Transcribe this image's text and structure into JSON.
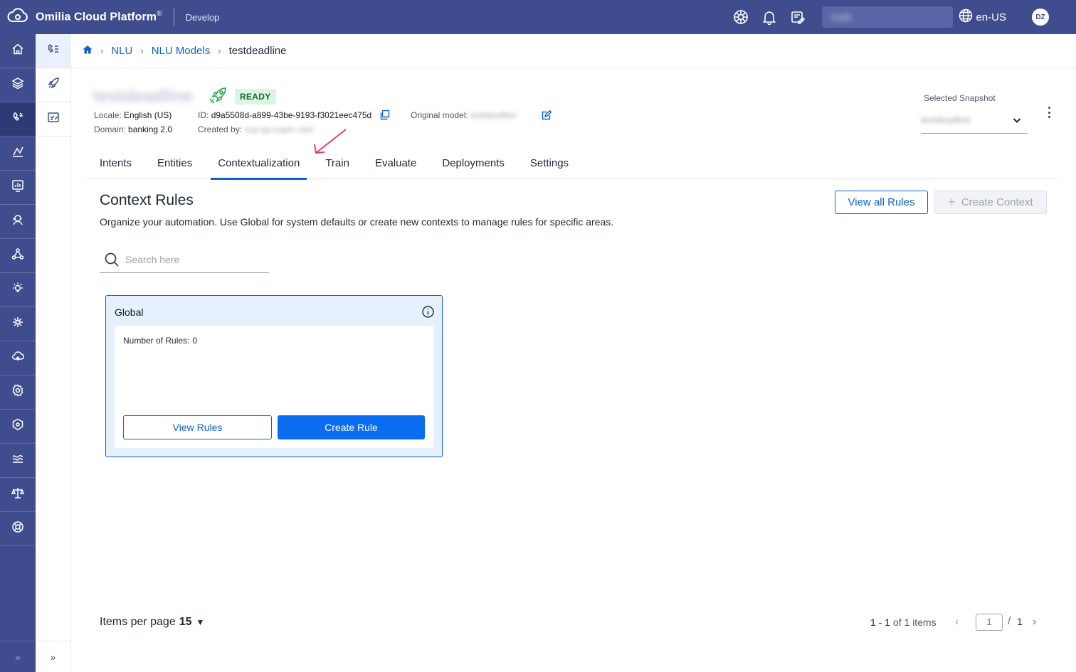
{
  "app": {
    "name": "Omilia Cloud Platform",
    "registered": "®",
    "environment": "Develop"
  },
  "topbar": {
    "user_field_value": "Rafik",
    "language": "en-US",
    "avatar_initials": "DZ"
  },
  "breadcrumb": {
    "items": [
      "NLU",
      "NLU Models"
    ],
    "current": "testdeadline"
  },
  "model": {
    "name": "testdeadline",
    "status": "READY",
    "locale_label": "Locale:",
    "locale_value": "English (US)",
    "id_label": "ID:",
    "id_value": "d9a5508d-a899-43be-9193-f3021eec475d",
    "original_model_label": "Original model:",
    "original_model_value": "testdeadline",
    "domain_label": "Domain:",
    "domain_value": "banking 2.0",
    "created_by_label": "Created by:",
    "created_by_value": "ocp-qa-super-user"
  },
  "snapshot": {
    "label": "Selected Snapshot",
    "value": "testdeadline"
  },
  "tabs": [
    {
      "label": "Intents"
    },
    {
      "label": "Entities"
    },
    {
      "label": "Contextualization"
    },
    {
      "label": "Train"
    },
    {
      "label": "Evaluate"
    },
    {
      "label": "Deployments"
    },
    {
      "label": "Settings"
    }
  ],
  "active_tab": "Contextualization",
  "content": {
    "title": "Context Rules",
    "description": "Organize your automation. Use Global for system defaults or create new contexts to manage rules for specific areas.",
    "view_all_rules": "View all Rules",
    "create_context": "Create Context",
    "search_placeholder": "Search here"
  },
  "card": {
    "title": "Global",
    "rules_label": "Number of Rules:",
    "rules_count": "0",
    "view_rules": "View Rules",
    "create_rule": "Create Rule"
  },
  "pagination": {
    "items_per_page_label": "Items per page",
    "items_per_page_value": "15",
    "range": "1 - 1",
    "range_suffix": "of 1 items",
    "current_page": "1",
    "page_sep": "/",
    "total_pages": "1"
  },
  "colors": {
    "brand": "#3f4d8f",
    "accent": "#0b63ce",
    "ready_bg": "#dcf5e3",
    "annotation_arrow": "#e23b7c"
  },
  "icons": {
    "topbar": [
      "cloud-logo-icon",
      "theme-icon",
      "bell-icon",
      "notes-icon",
      "globe-icon"
    ],
    "rail": [
      "home-icon",
      "layers-icon",
      "nlu-icon",
      "analytics-icon",
      "monitor-icon",
      "agent-icon",
      "network-icon",
      "idea-icon",
      "ai-icon",
      "cloud-upload-icon",
      "settings-icon",
      "security-icon",
      "flow-icon",
      "balance-icon",
      "support-icon"
    ],
    "rail2": [
      "models-icon",
      "rocket-icon",
      "checklist-icon"
    ]
  }
}
